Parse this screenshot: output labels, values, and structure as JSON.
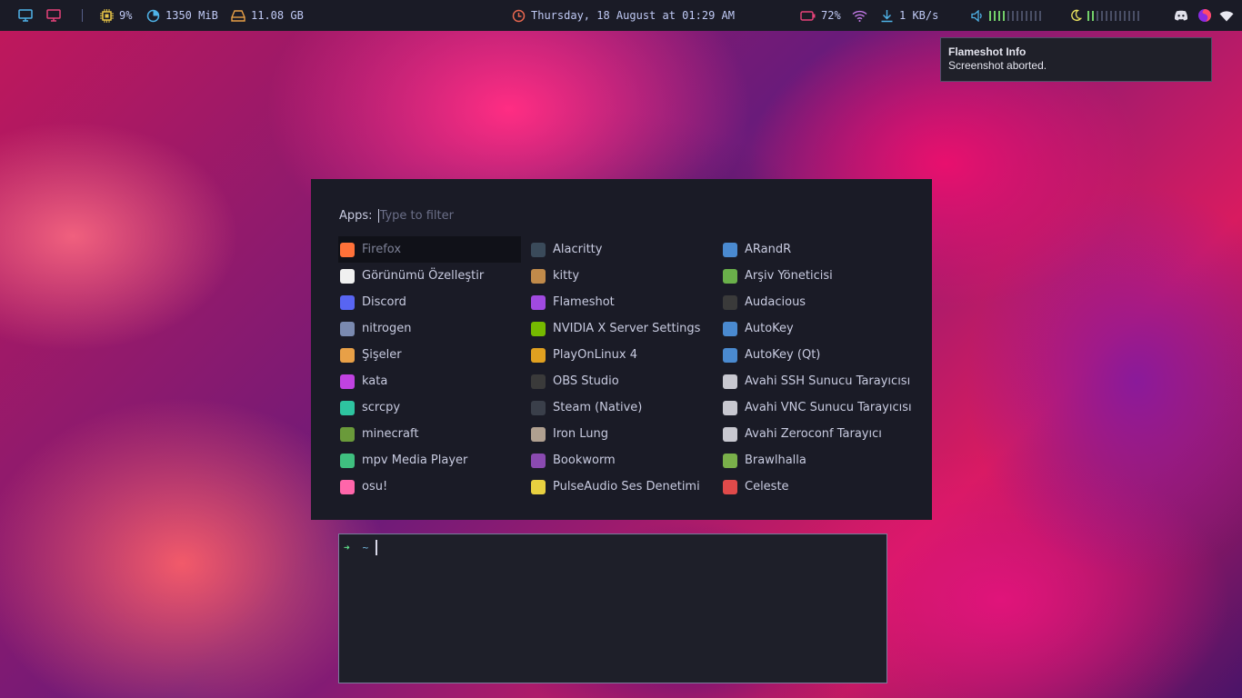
{
  "topbar": {
    "cpu": "9%",
    "memory": "1350 MiB",
    "disk": "11.08 GB",
    "datetime": "Thursday, 18 August at 01:29 AM",
    "battery": "72%",
    "network_speed": "1 KB/s",
    "volume_level_bars": 4,
    "volume_total_bars": 12,
    "brightness_level_bars": 2,
    "brightness_total_bars": 12,
    "colors": {
      "bar_bg": "#1a1b26",
      "workspace_1": "#4fb3e8",
      "workspace_2": "#e8437a",
      "cpu_icon": "#e8c547",
      "memory_icon": "#4fb3e8",
      "disk_icon": "#e8a047",
      "clock_icon": "#e8674f",
      "battery_icon": "#e8437a",
      "wifi_icon": "#c47ae8",
      "download_icon": "#4fb3e8",
      "volume_icon": "#4fb3e8",
      "volume_bars": "#73d06a",
      "moon_icon": "#e8e05f"
    }
  },
  "notification": {
    "title": "Flameshot Info",
    "body": "Screenshot aborted."
  },
  "launcher": {
    "prompt_label": "Apps:",
    "placeholder": "Type to filter",
    "columns": [
      [
        {
          "label": "Firefox",
          "icon": "firefox-icon",
          "color": "#ff7139",
          "selected": true
        },
        {
          "label": "Görünümü Özelleştir",
          "icon": "shirt-icon",
          "color": "#f0f0f0"
        },
        {
          "label": "Discord",
          "icon": "discord-icon",
          "color": "#5865f2"
        },
        {
          "label": "nitrogen",
          "icon": "nitrogen-icon",
          "color": "#7a8ab0"
        },
        {
          "label": "Şişeler",
          "icon": "bottles-icon",
          "color": "#e8a047"
        },
        {
          "label": "kata",
          "icon": "kata-icon",
          "color": "#c042e0"
        },
        {
          "label": "scrcpy",
          "icon": "scrcpy-icon",
          "color": "#2ec4a0"
        },
        {
          "label": "minecraft",
          "icon": "minecraft-icon",
          "color": "#6a9a3a"
        },
        {
          "label": "mpv Media Player",
          "icon": "mpv-icon",
          "color": "#3fbf7f"
        },
        {
          "label": "osu!",
          "icon": "osu-icon",
          "color": "#ff66aa"
        }
      ],
      [
        {
          "label": "Alacritty",
          "icon": "alacritty-icon",
          "color": "#3a4a5a"
        },
        {
          "label": "kitty",
          "icon": "kitty-icon",
          "color": "#c08a4a"
        },
        {
          "label": "Flameshot",
          "icon": "flameshot-icon",
          "color": "#a04ae0"
        },
        {
          "label": "NVIDIA X Server Settings",
          "icon": "nvidia-icon",
          "color": "#76b900"
        },
        {
          "label": "PlayOnLinux 4",
          "icon": "playonlinux-icon",
          "color": "#e0a020"
        },
        {
          "label": "OBS Studio",
          "icon": "obs-icon",
          "color": "#3a3a3a"
        },
        {
          "label": "Steam (Native)",
          "icon": "steam-icon",
          "color": "#3a3f4a"
        },
        {
          "label": "Iron Lung",
          "icon": "iron-lung-icon",
          "color": "#b0a090"
        },
        {
          "label": "Bookworm",
          "icon": "bookworm-icon",
          "color": "#8a4ab0"
        },
        {
          "label": "PulseAudio Ses Denetimi",
          "icon": "pulseaudio-icon",
          "color": "#e8d040"
        }
      ],
      [
        {
          "label": "ARandR",
          "icon": "arandr-icon",
          "color": "#4a8ad0"
        },
        {
          "label": "Arşiv Yöneticisi",
          "icon": "archive-manager-icon",
          "color": "#6ab04a"
        },
        {
          "label": "Audacious",
          "icon": "audacious-icon",
          "color": "#3a3a3a"
        },
        {
          "label": "AutoKey",
          "icon": "autokey-icon",
          "color": "#4a8ad0"
        },
        {
          "label": "AutoKey (Qt)",
          "icon": "autokey-qt-icon",
          "color": "#4a8ad0"
        },
        {
          "label": "Avahi SSH Sunucu Tarayıcısı",
          "icon": "avahi-ssh-icon",
          "color": "#c8c8d0"
        },
        {
          "label": "Avahi VNC Sunucu Tarayıcısı",
          "icon": "avahi-vnc-icon",
          "color": "#c8c8d0"
        },
        {
          "label": "Avahi Zeroconf Tarayıcı",
          "icon": "avahi-zeroconf-icon",
          "color": "#c8c8d0"
        },
        {
          "label": "Brawlhalla",
          "icon": "brawlhalla-icon",
          "color": "#7ab04a"
        },
        {
          "label": "Celeste",
          "icon": "celeste-icon",
          "color": "#e04a4a"
        }
      ]
    ]
  },
  "terminal": {
    "prompt_arrow": "➜",
    "cwd": "~"
  }
}
